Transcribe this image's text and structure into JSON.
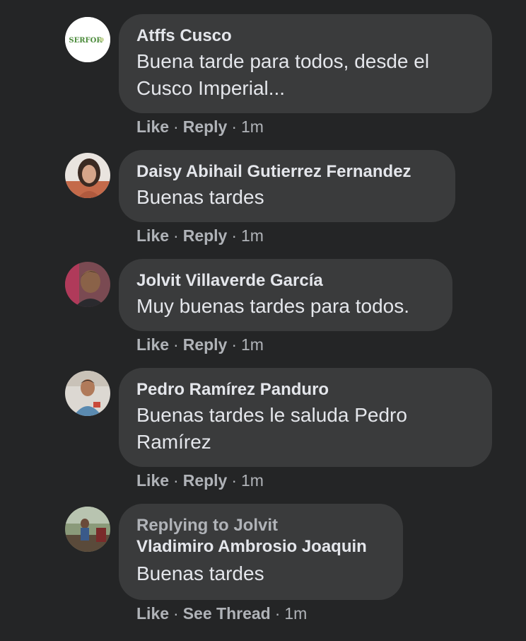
{
  "comments": [
    {
      "avatar": "serfor-logo-avatar",
      "avatar_text": "SERFOR",
      "author": "Atffs Cusco",
      "text_lines": [
        "Buena tarde para todos, desde el",
        "Cusco Imperial..."
      ],
      "actions": {
        "like": "Like",
        "reply": "Reply",
        "time": "1m"
      }
    },
    {
      "avatar": "woman-photo-avatar",
      "author": "Daisy Abihail Gutierrez Fernandez",
      "text_lines": [
        "Buenas tardes"
      ],
      "actions": {
        "like": "Like",
        "reply": "Reply",
        "time": "1m"
      }
    },
    {
      "avatar": "man-photo-avatar",
      "author": "Jolvit Villaverde García",
      "text_lines": [
        "Muy buenas tardes para todos."
      ],
      "actions": {
        "like": "Like",
        "reply": "Reply",
        "time": "1m"
      }
    },
    {
      "avatar": "man-photo-avatar",
      "author": "Pedro Ramírez Panduro",
      "text_lines": [
        "Buenas tardes le saluda Pedro",
        "Ramírez"
      ],
      "actions": {
        "like": "Like",
        "reply": "Reply",
        "time": "1m"
      }
    },
    {
      "avatar": "outdoor-photo-avatar",
      "replying_to": "Replying to Jolvit",
      "author": "Vladimiro Ambrosio Joaquin",
      "text_lines": [
        "Buenas tardes"
      ],
      "actions": {
        "like": "Like",
        "reply": "See Thread",
        "time": "1m"
      }
    }
  ],
  "separator": "·"
}
